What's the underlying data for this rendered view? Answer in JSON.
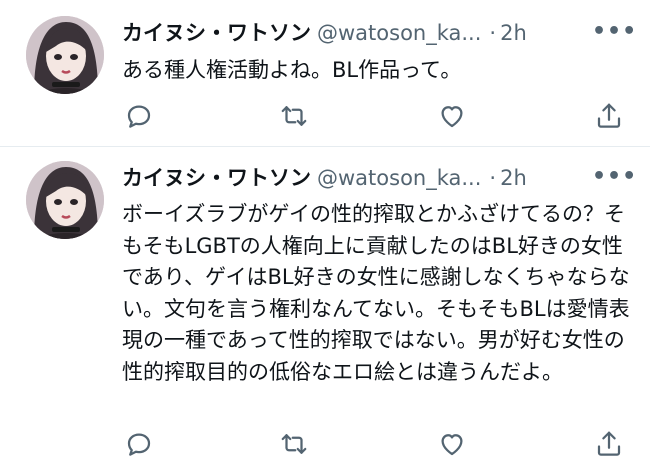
{
  "tweets": [
    {
      "display_name": "カイヌシ・ワトソン",
      "handle": "@watoson_ka...",
      "separator": "·",
      "time": "2h",
      "more_label": "•••",
      "text": "ある種人権活動よね。BL作品って。"
    },
    {
      "display_name": "カイヌシ・ワトソン",
      "handle": "@watoson_ka...",
      "separator": "·",
      "time": "2h",
      "more_label": "•••",
      "text": "ボーイズラブがゲイの性的搾取とかふざけてるの？そもそもLGBTの人権向上に貢献したのはBL好きの女性であり、ゲイはBL好きの女性に感謝しなくちゃならない。文句を言う権利なんてない。そもそもBLは愛情表現の一種であって性的搾取ではない。男が好む女性の性的搾取目的の低俗なエロ絵とは違うんだよ。"
    }
  ],
  "actions": {
    "reply": "reply-icon",
    "retweet": "retweet-icon",
    "like": "heart-icon",
    "share": "share-icon"
  },
  "colors": {
    "text": "#0f1419",
    "secondary": "#536471",
    "divider": "#e6ecf0"
  }
}
